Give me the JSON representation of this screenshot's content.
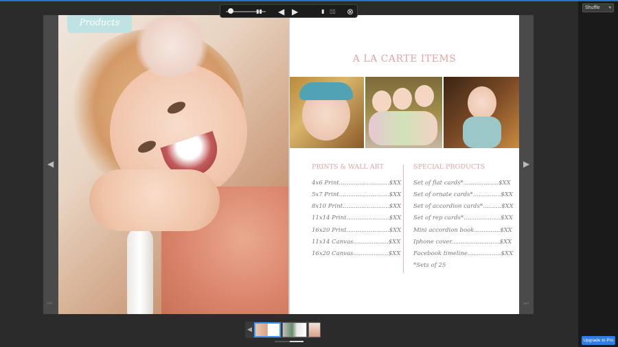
{
  "app": {
    "shuffle_label": "Shuffle",
    "upgrade_label": "Upgrade to Pro"
  },
  "toolbar": {
    "prev_icon": "triangle-left-icon",
    "next_icon": "triangle-right-icon",
    "close_icon": "close-circle-icon"
  },
  "left_page": {
    "tag": "Products"
  },
  "right_page": {
    "title": "A LA CARTE ITEMS",
    "left_column": {
      "heading": "PRINTS & WALL ART",
      "items": [
        "4x6 Print...........................$XX",
        "5x7 Print...........................$XX",
        "8x10 Print.........................$XX",
        "11x14 Print.......................$XX",
        "16x20 Print.......................$XX",
        "11x14 Canvas...................$XX",
        "16x20 Canvas...................$XX"
      ]
    },
    "right_column": {
      "heading": "SPECIAL PRODUCTS",
      "items": [
        "Set of flat cards*...................$XX",
        "Set of ornate cards*...............$XX",
        "Set of accordion cards*..........$XX",
        "Set of rep cards*....................$XX",
        "Mini accordion book..............$XX",
        "Iphone cover..........................$XX",
        "Facebook timeline..................$XX"
      ],
      "note": "*Sets of 25"
    }
  },
  "colors": {
    "accent_pink": "#e3a4a4",
    "tag_teal": "#bfe3e2",
    "upgrade_blue": "#2a7fe0"
  }
}
